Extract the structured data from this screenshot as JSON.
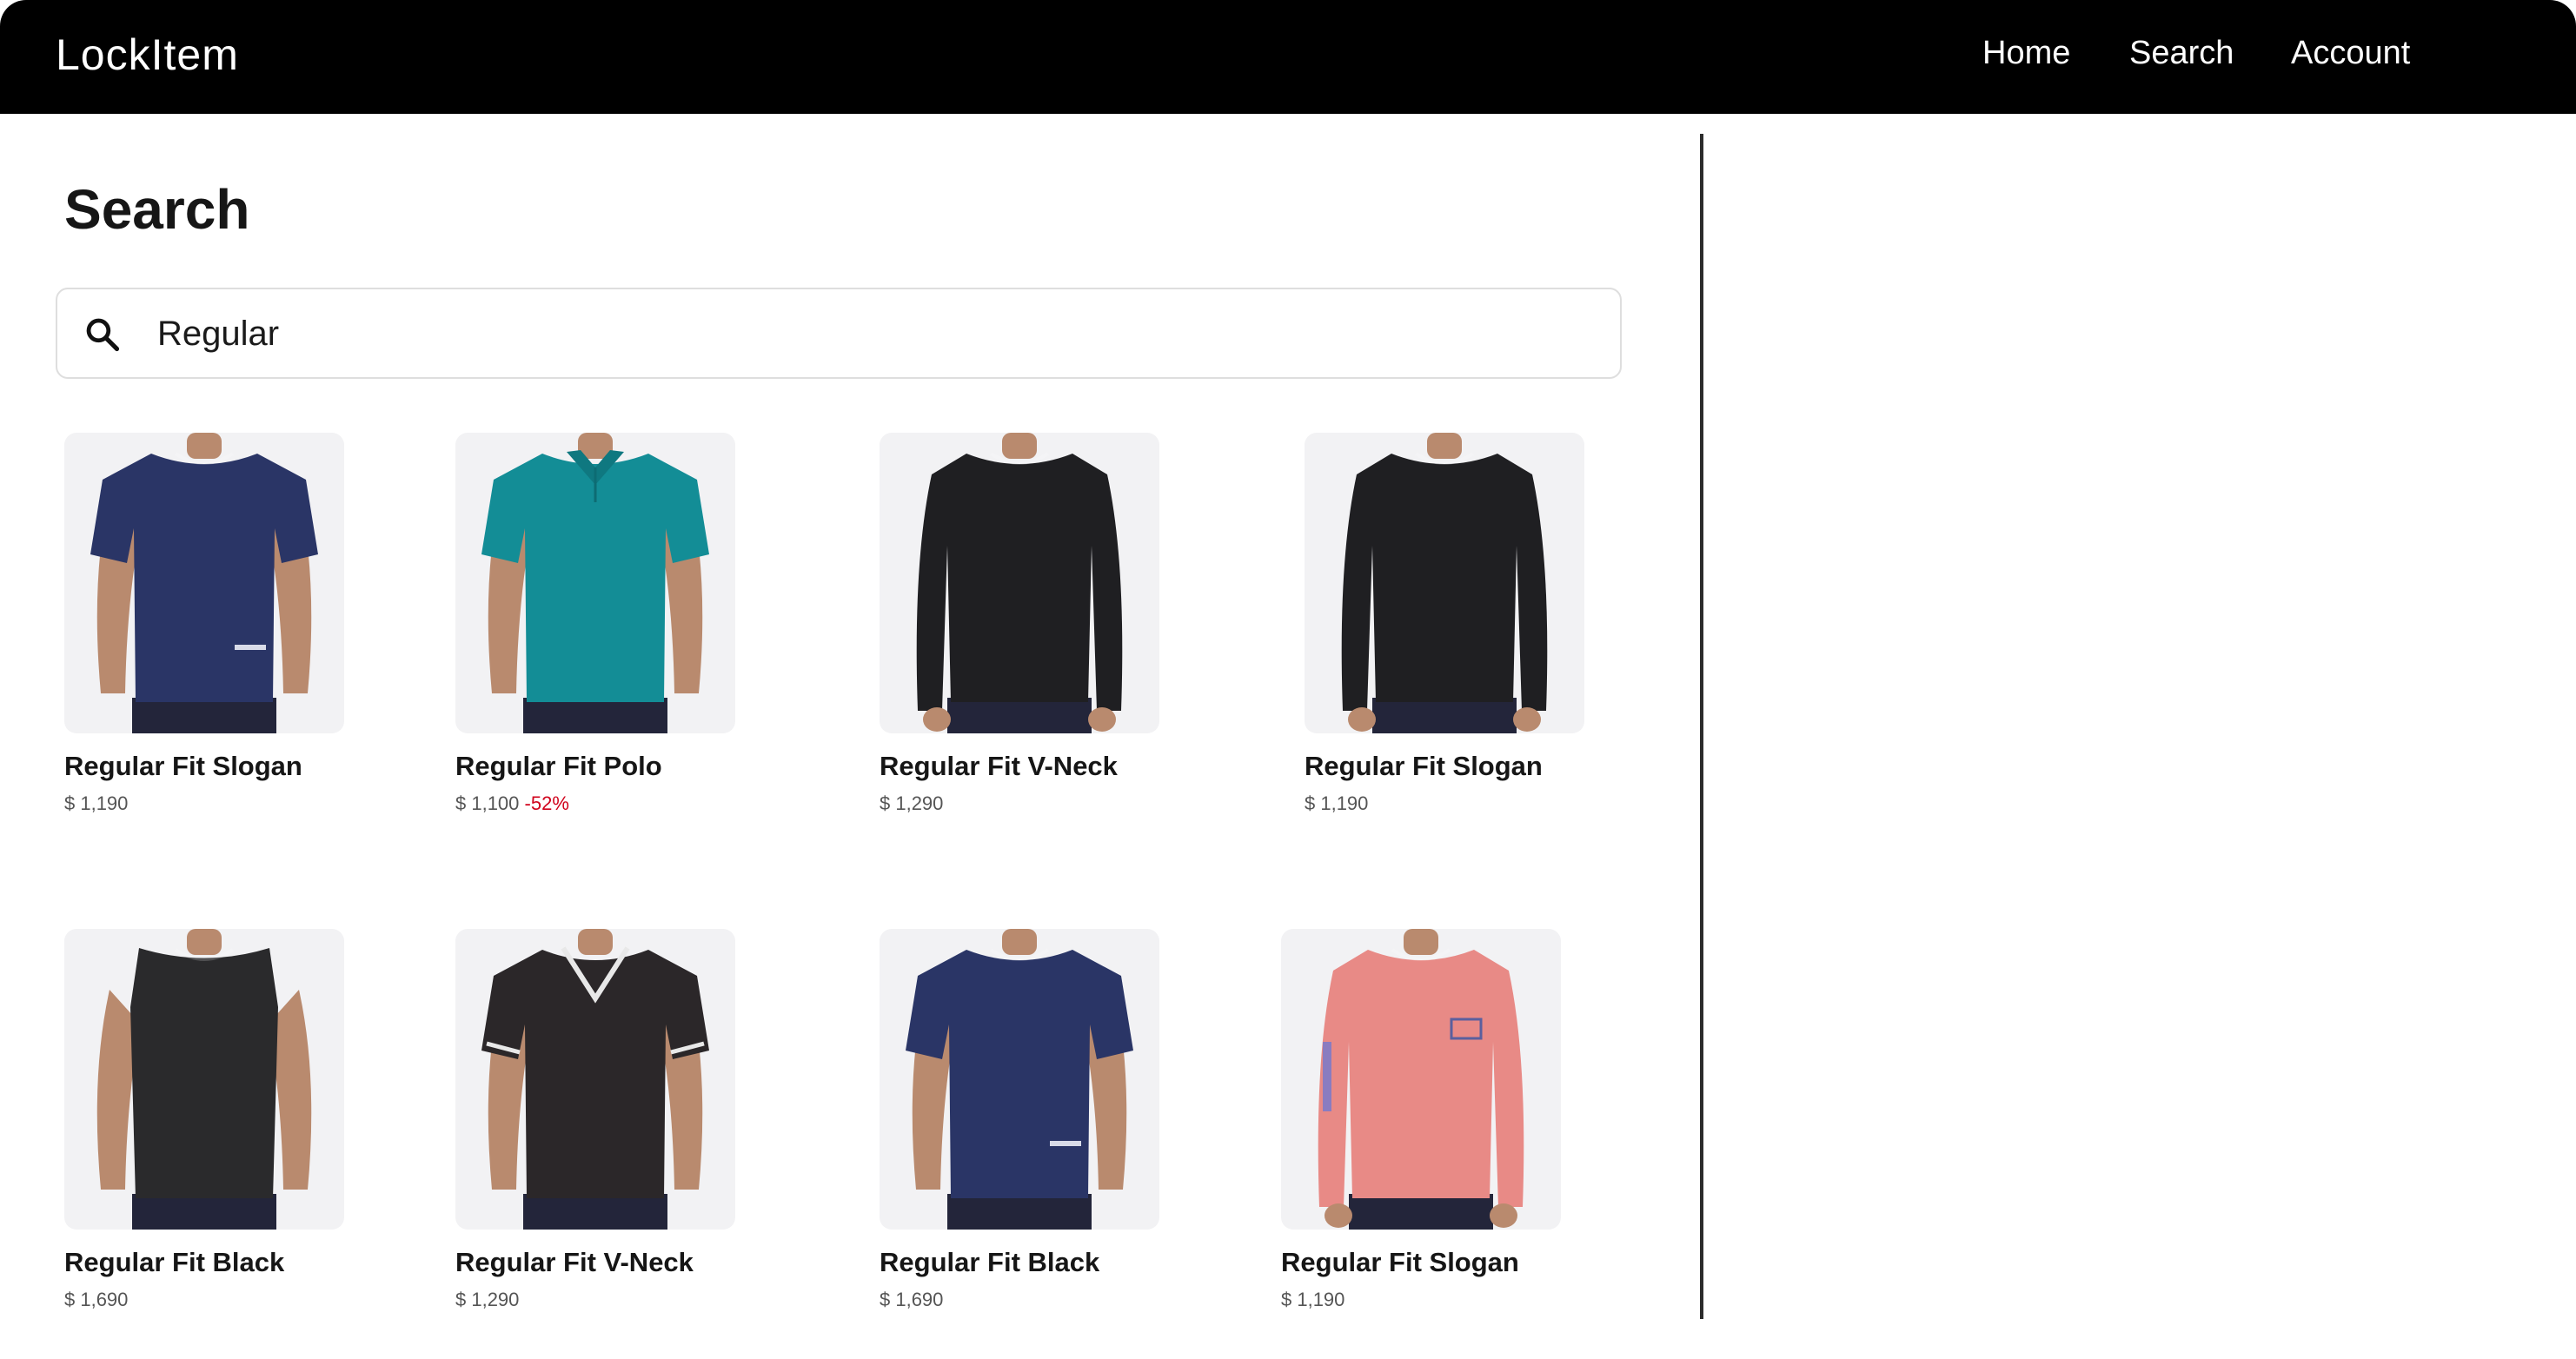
{
  "header": {
    "brand": "LockItem",
    "nav": [
      "Home",
      "Search",
      "Account"
    ]
  },
  "main": {
    "title": "Search",
    "search": {
      "value": "Regular",
      "icon": "search-icon"
    }
  },
  "products": [
    {
      "name": "Regular Fit Slogan",
      "price": "$ 1,190",
      "discount": "",
      "garment": "tee",
      "color": "#2a3566",
      "sleeve": "short"
    },
    {
      "name": "Regular Fit Polo",
      "price": "$ 1,100",
      "discount": "-52%",
      "garment": "polo",
      "color": "#138d96",
      "sleeve": "short"
    },
    {
      "name": "Regular Fit V-Neck",
      "price": "$ 1,290",
      "discount": "",
      "garment": "longsleeve",
      "color": "#1f1f22",
      "sleeve": "long"
    },
    {
      "name": "Regular Fit Slogan",
      "price": "$ 1,190",
      "discount": "",
      "garment": "longsleeve",
      "color": "#1f1f22",
      "sleeve": "long"
    },
    {
      "name": "Regular Fit Black",
      "price": "$ 1,690",
      "discount": "",
      "garment": "tank",
      "color": "#2a2a2c",
      "sleeve": "none"
    },
    {
      "name": "Regular Fit V-Neck",
      "price": "$ 1,290",
      "discount": "",
      "garment": "vneck",
      "color": "#2b2729",
      "sleeve": "short"
    },
    {
      "name": "Regular Fit Black",
      "price": "$ 1,690",
      "discount": "",
      "garment": "tee",
      "color": "#2a3566",
      "sleeve": "short"
    },
    {
      "name": "Regular Fit Slogan",
      "price": "$ 1,190",
      "discount": "",
      "garment": "longsleeve",
      "color": "#e88a86",
      "sleeve": "long"
    }
  ],
  "colors": {
    "navbar_bg": "#000000",
    "discount": "#d0021b",
    "divider": "#2c2c2c",
    "image_bg": "#f2f2f4",
    "skin": "#b98a6e"
  }
}
